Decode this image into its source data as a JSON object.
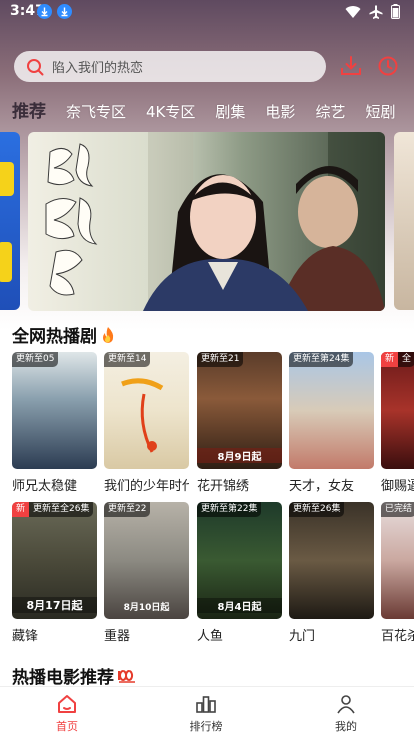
{
  "status_bar": {
    "time": "3:47"
  },
  "search": {
    "placeholder": "陷入我们的热恋"
  },
  "tabs": [
    {
      "label": "推荐",
      "active": true
    },
    {
      "label": "奈飞专区"
    },
    {
      "label": "4K专区"
    },
    {
      "label": "剧集"
    },
    {
      "label": "电影"
    },
    {
      "label": "综艺"
    },
    {
      "label": "短剧"
    }
  ],
  "banner": {
    "title_art": "灿如繁星"
  },
  "hot_section": {
    "title": "全网热播剧",
    "icon": "fire-icon"
  },
  "row1": [
    {
      "title": "师兄太稳健",
      "badge": "更新至05"
    },
    {
      "title": "我们的少年时代",
      "badge": "更新至14"
    },
    {
      "title": "花开锦绣",
      "badge": "更新至21",
      "poster_text": "8月9日起"
    },
    {
      "title": "天才，女友",
      "badge": "更新至第24集"
    },
    {
      "title": "御赐逼婚",
      "badge": "新",
      "badge2": "全"
    }
  ],
  "row2": [
    {
      "title": "藏锋",
      "badge": "新",
      "badge2": "更新至全26集",
      "poster_text": "8月17日起"
    },
    {
      "title": "重器",
      "badge": "更新至22",
      "poster_text": "8月10日起"
    },
    {
      "title": "人鱼",
      "badge": "更新至第22集",
      "poster_text": "8月4日起"
    },
    {
      "title": "九门",
      "badge": "更新至26集"
    },
    {
      "title": "百花杀",
      "badge": "已完结"
    }
  ],
  "movie_section": {
    "title": "热播电影推荐",
    "icon": "hundred-icon"
  },
  "bottom_nav": [
    {
      "label": "首页",
      "active": true,
      "icon": "home-icon"
    },
    {
      "label": "排行榜",
      "icon": "ranking-icon"
    },
    {
      "label": "我的",
      "icon": "profile-icon"
    }
  ],
  "colors": {
    "accent": "#f04141",
    "tab_active": "#3a2d3a"
  }
}
